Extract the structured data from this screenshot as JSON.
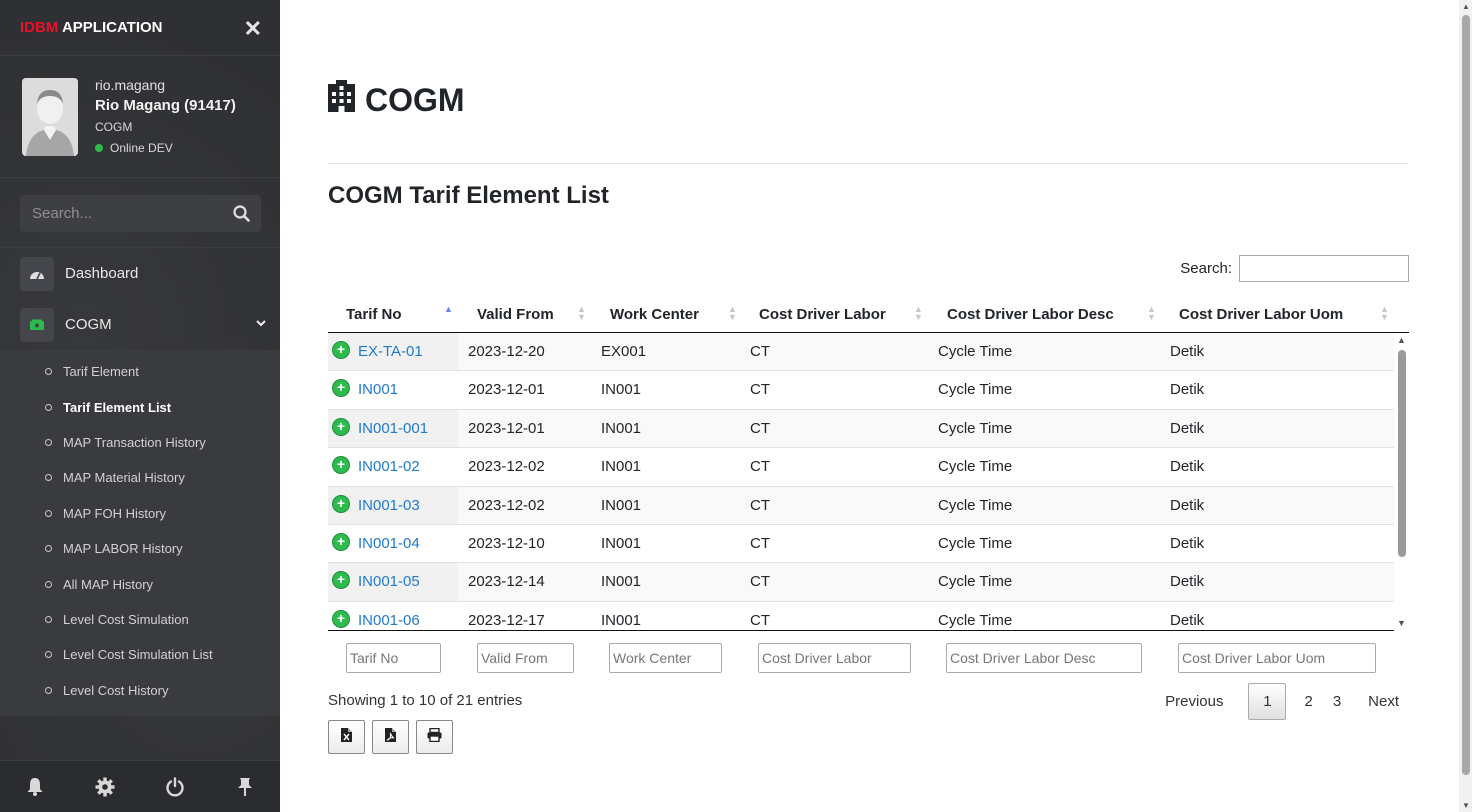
{
  "app": {
    "brand_red": "IDBM",
    "brand_rest": " APPLICATION"
  },
  "user": {
    "username": "rio.magang",
    "fullname": "Rio Magang (91417)",
    "role": "COGM",
    "status": "Online DEV"
  },
  "sidebar": {
    "search_placeholder": "Search...",
    "menu": [
      {
        "label": "Dashboard",
        "icon": "dashboard-icon"
      },
      {
        "label": "COGM",
        "icon": "money-icon"
      }
    ],
    "submenu": [
      {
        "label": "Tarif Element",
        "active": false
      },
      {
        "label": "Tarif Element List",
        "active": true
      },
      {
        "label": "MAP Transaction History",
        "active": false
      },
      {
        "label": "MAP Material History",
        "active": false
      },
      {
        "label": "MAP FOH History",
        "active": false
      },
      {
        "label": "MAP LABOR History",
        "active": false
      },
      {
        "label": "All MAP History",
        "active": false
      },
      {
        "label": "Level Cost Simulation",
        "active": false
      },
      {
        "label": "Level Cost Simulation List",
        "active": false
      },
      {
        "label": "Level Cost History",
        "active": false
      }
    ]
  },
  "page": {
    "title": "COGM",
    "subtitle": "COGM Tarif Element List",
    "search_label": "Search:"
  },
  "table": {
    "columns": [
      "Tarif No",
      "Valid From",
      "Work Center",
      "Cost Driver Labor",
      "Cost Driver Labor Desc",
      "Cost Driver Labor Uom"
    ],
    "rows": [
      [
        "EX-TA-01",
        "2023-12-20",
        "EX001",
        "CT",
        "Cycle Time",
        "Detik"
      ],
      [
        "IN001",
        "2023-12-01",
        "IN001",
        "CT",
        "Cycle Time",
        "Detik"
      ],
      [
        "IN001-001",
        "2023-12-01",
        "IN001",
        "CT",
        "Cycle Time",
        "Detik"
      ],
      [
        "IN001-02",
        "2023-12-02",
        "IN001",
        "CT",
        "Cycle Time",
        "Detik"
      ],
      [
        "IN001-03",
        "2023-12-02",
        "IN001",
        "CT",
        "Cycle Time",
        "Detik"
      ],
      [
        "IN001-04",
        "2023-12-10",
        "IN001",
        "CT",
        "Cycle Time",
        "Detik"
      ],
      [
        "IN001-05",
        "2023-12-14",
        "IN001",
        "CT",
        "Cycle Time",
        "Detik"
      ],
      [
        "IN001-06",
        "2023-12-17",
        "IN001",
        "CT",
        "Cycle Time",
        "Detik"
      ]
    ],
    "filter_placeholders": [
      "Tarif No",
      "Valid From",
      "Work Center",
      "Cost Driver Labor",
      "Cost Driver Labor Desc",
      "Cost Driver Labor Uom"
    ],
    "info": "Showing 1 to 10 of 21 entries"
  },
  "pagination": {
    "previous": "Previous",
    "pages": [
      "1",
      "2",
      "3"
    ],
    "current": "1",
    "next": "Next"
  },
  "colors": {
    "accent_red": "#e8102a",
    "link": "#1f7bd0",
    "online": "#2dbb4e",
    "sidebar_bg": "#2f3033"
  }
}
